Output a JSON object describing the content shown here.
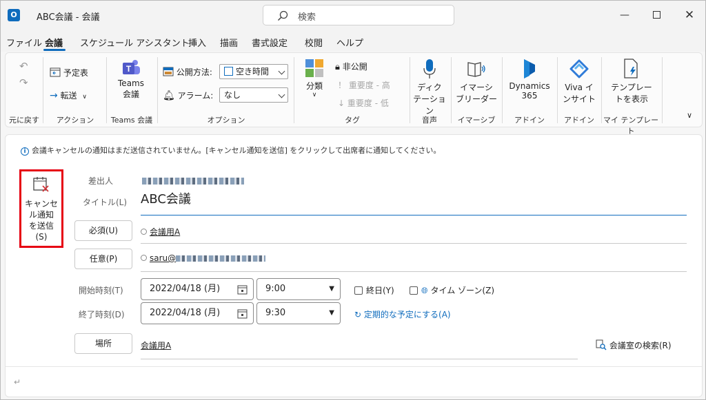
{
  "window": {
    "title": "ABC会議 - 会議",
    "search_placeholder": "検索"
  },
  "menu": [
    "ファイル",
    "会議",
    "スケジュール アシスタント",
    "挿入",
    "描画",
    "書式設定",
    "校閲",
    "ヘルプ"
  ],
  "ribbon": {
    "undo_group": "元に戻す",
    "action": {
      "calendar": "予定表",
      "forward": "転送",
      "group": "アクション"
    },
    "teams": {
      "line1": "Teams",
      "line2": "会議",
      "group": "Teams 会議"
    },
    "options": {
      "show_as_label": "公開方法:",
      "show_as_value": "空き時間",
      "reminder_label": "アラーム:",
      "reminder_value": "なし",
      "group": "オプション"
    },
    "tags": {
      "category": "分類",
      "private": "非公開",
      "high": "重要度 - 高",
      "low": "重要度 - 低",
      "group": "タグ"
    },
    "voice": {
      "line1": "ディク",
      "line2": "テーション",
      "group": "音声"
    },
    "immersive": {
      "line1": "イマーシ",
      "line2": "ブリーダー",
      "group": "イマーシブ"
    },
    "dynamics": {
      "line1": "Dynamics",
      "line2": "365",
      "group": "アドイン"
    },
    "viva": {
      "line1": "Viva イ",
      "line2": "ンサイト",
      "group": "アドイン"
    },
    "templates": {
      "line1": "テンプレー",
      "line2": "トを表示",
      "group": "マイ テンプレート"
    }
  },
  "info_bar": "会議キャンセルの通知はまだ送信されていません。[キャンセル通知を送信] をクリックして出席者に通知してください。",
  "send": {
    "line1": "キャンセ",
    "line2": "ル通知",
    "line3": "を送信",
    "line4": "(S)"
  },
  "form": {
    "from_label": "差出人",
    "title_label": "タイトル(L)",
    "title_value": "ABC会議",
    "required_btn": "必須(U)",
    "required_value": "会議用A",
    "optional_btn": "任意(P)",
    "optional_value": "saru@",
    "start_label": "開始時刻(T)",
    "start_date": "2022/04/18 (月)",
    "start_time": "9:00",
    "allday": "終日(Y)",
    "timezone": "タイム ゾーン(Z)",
    "end_label": "終了時刻(D)",
    "end_date": "2022/04/18 (月)",
    "end_time": "9:30",
    "recurring": "定期的な予定にする(A)",
    "location_btn": "場所",
    "location_value": "会議用A",
    "room_finder": "会議室の検索(R)"
  },
  "body_mark": "↵",
  "colors": {
    "accent": "#0f6cbd",
    "highlight": "#e60012"
  }
}
